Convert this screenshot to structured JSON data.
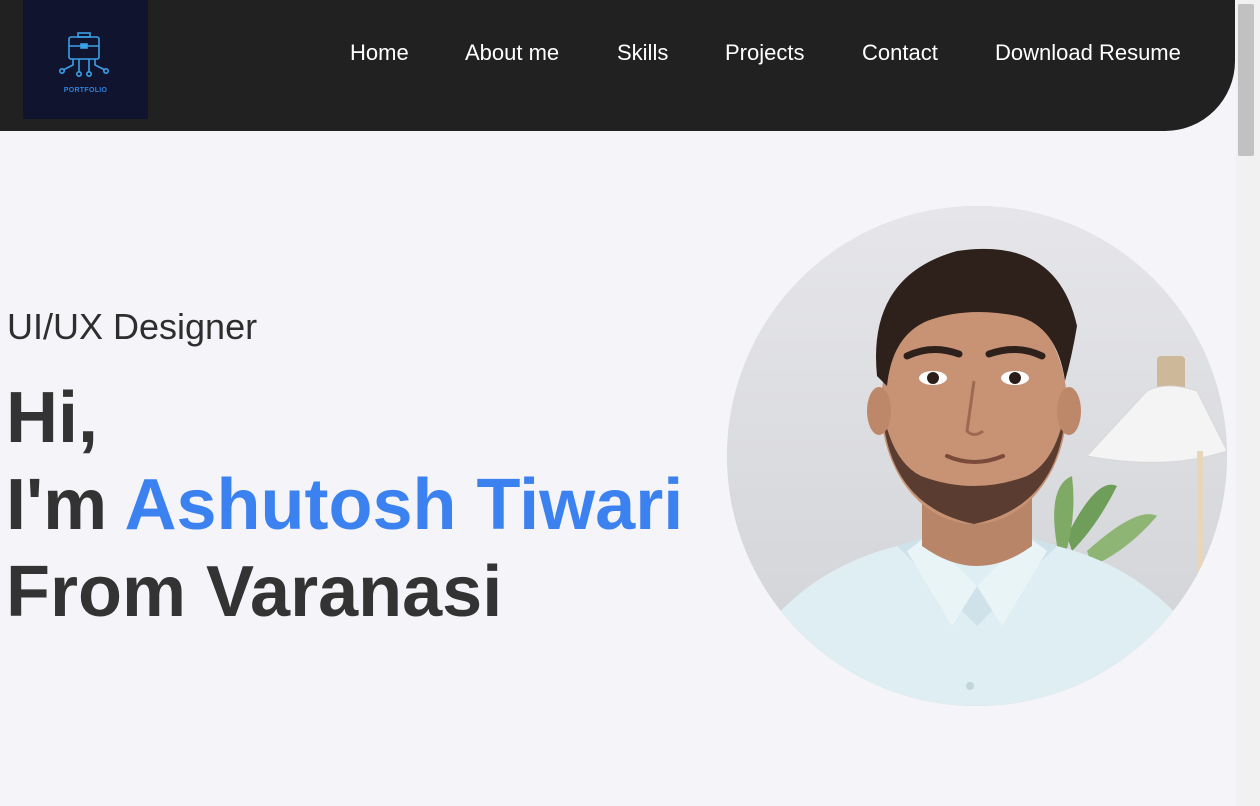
{
  "logo": {
    "text": "PORTFOLIO",
    "icon": "briefcase-circuit-icon",
    "accent": "#2f7fd8"
  },
  "nav": {
    "items": [
      {
        "label": "Home"
      },
      {
        "label": "About me"
      },
      {
        "label": "Skills"
      },
      {
        "label": "Projects"
      },
      {
        "label": "Contact"
      },
      {
        "label": "Download Resume"
      }
    ]
  },
  "hero": {
    "role": "UI/UX Designer",
    "greeting": "Hi,",
    "intro_prefix": "I'm ",
    "name": "Ashutosh Tiwari",
    "location_line": "From Varanasi",
    "name_color": "#3b82f0"
  },
  "colors": {
    "navbar": "#212121",
    "background": "#f5f4f8",
    "text": "#333333"
  }
}
